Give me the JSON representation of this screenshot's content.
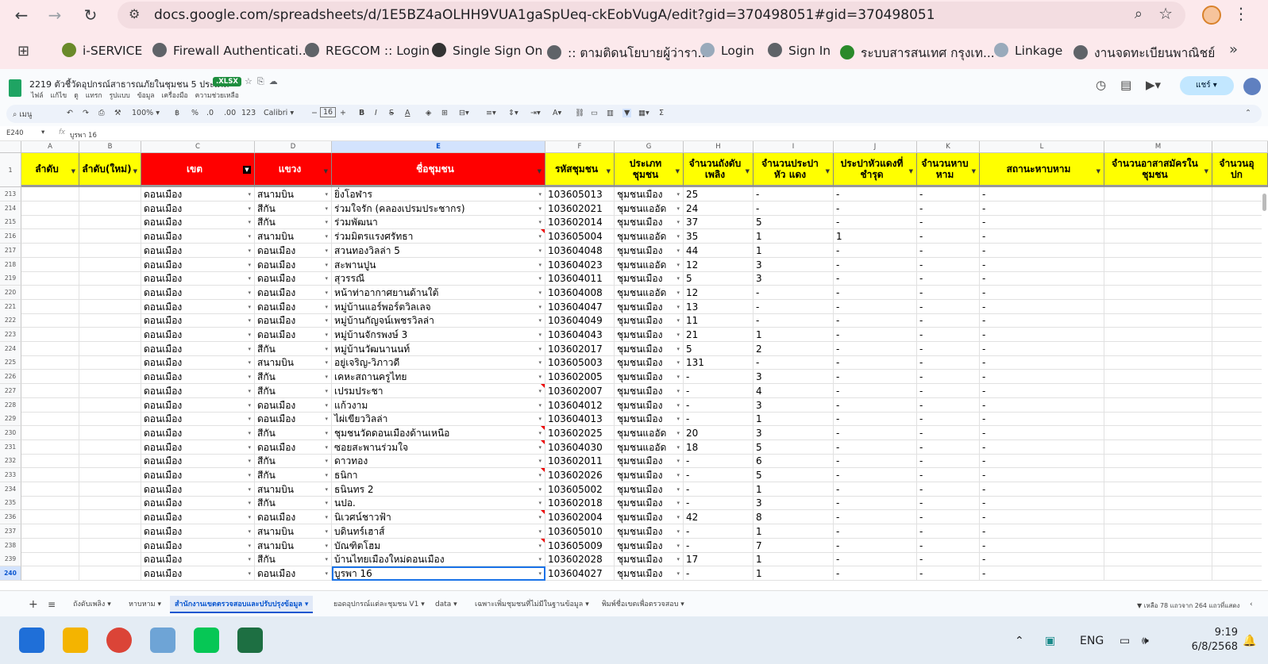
{
  "browser": {
    "url": "docs.google.com/spreadsheets/d/1E5BZ4aOLHH9VUA1gaSpUeq-ckEobVugA/edit?gid=370498051#gid=370498051",
    "bookmarks": [
      "i-SERVICE",
      "Firewall Authenticati...",
      "REGCOM :: Login",
      "Single Sign On",
      ":: ตามติดนโยบายผู้ว่ารา...",
      "Login",
      "Sign In",
      "ระบบสารสนเทศ กรุงเท...",
      "Linkage",
      "งานจดทะเบียนพาณิชย์"
    ]
  },
  "sheet": {
    "title": "2219 ตัวชี้วัดอุปกรณ์สาธารณภัยในชุมชน 5 ประเภท",
    "badge": ".XLSX",
    "menus": [
      "ไฟล์",
      "แก้ไข",
      "ดู",
      "แทรก",
      "รูปแบบ",
      "ข้อมูล",
      "เครื่องมือ",
      "ความช่วยเหลือ"
    ],
    "share_label": "แชร์",
    "toolbar": {
      "search": "เมนู",
      "zoom": "100%",
      "currency": "฿",
      "percent": "%",
      "dec1": ".0",
      "dec2": ".00",
      "fmt": "123",
      "font": "Calibri",
      "size": "16"
    },
    "cell_ref": "E240",
    "formula": "บูรพา 16"
  },
  "columns": {
    "letters": [
      "A",
      "B",
      "C",
      "D",
      "E",
      "F",
      "G",
      "H",
      "I",
      "J",
      "K",
      "L",
      "M",
      ""
    ],
    "headers": [
      "ลำดับ",
      "ลำดับ(ใหม่)",
      "เขต",
      "แขวง",
      "ชื่อชุมชน",
      "รหัสชุมชน",
      "ประเภท ชุมชน",
      "จำนวนถังดับ เพลิง",
      "จำนวนประปาหัว แดง",
      "ประปาหัวแดงที่ ชำรุด",
      "จำนวนหาบ หาม",
      "สถานะหาบหาม",
      "จำนวนอาสาสมัครใน ชุมชน",
      "จำนวนอุปก"
    ]
  },
  "rows": [
    {
      "n": "213",
      "c": "ดอนเมือง",
      "d": "สนามบิน",
      "e": "ยิ่งโอฬาร",
      "f": "103605013",
      "g": "ชุมชนเมือง",
      "h": "25",
      "i": "-",
      "j": "-",
      "k": "-",
      "l": "-"
    },
    {
      "n": "214",
      "c": "ดอนเมือง",
      "d": "สีกัน",
      "e": "ร่วมใจรัก (คลองเปรมประชากร)",
      "f": "103602021",
      "g": "ชุมชนแออัด",
      "h": "24",
      "i": "-",
      "j": "-",
      "k": "-",
      "l": "-"
    },
    {
      "n": "215",
      "c": "ดอนเมือง",
      "d": "สีกัน",
      "e": "ร่วมพัฒนา",
      "f": "103602014",
      "g": "ชุมชนเมือง",
      "h": "37",
      "i": "5",
      "j": "-",
      "k": "-",
      "l": "-"
    },
    {
      "n": "216",
      "c": "ดอนเมือง",
      "d": "สนามบิน",
      "e": "ร่วมมิตรแรงศรัทธา",
      "f": "103605004",
      "g": "ชุมชนแออัด",
      "h": "35",
      "i": "1",
      "j": "1",
      "k": "-",
      "l": "-"
    },
    {
      "n": "217",
      "c": "ดอนเมือง",
      "d": "ดอนเมือง",
      "e": "สวนทองวิลล่า 5",
      "f": "103604048",
      "g": "ชุมชนเมือง",
      "h": "44",
      "i": "1",
      "j": "-",
      "k": "-",
      "l": "-"
    },
    {
      "n": "218",
      "c": "ดอนเมือง",
      "d": "ดอนเมือง",
      "e": "สะพานปูน",
      "f": "103604023",
      "g": "ชุมชนแออัด",
      "h": "12",
      "i": "3",
      "j": "-",
      "k": "-",
      "l": "-"
    },
    {
      "n": "219",
      "c": "ดอนเมือง",
      "d": "ดอนเมือง",
      "e": "สุวรรณี",
      "f": "103604011",
      "g": "ชุมชนเมือง",
      "h": "5",
      "i": "3",
      "j": "-",
      "k": "-",
      "l": "-"
    },
    {
      "n": "220",
      "c": "ดอนเมือง",
      "d": "ดอนเมือง",
      "e": "หน้าท่าอากาศยานด้านใต้",
      "f": "103604008",
      "g": "ชุมชนแออัด",
      "h": "12",
      "i": "-",
      "j": "-",
      "k": "-",
      "l": "-"
    },
    {
      "n": "221",
      "c": "ดอนเมือง",
      "d": "ดอนเมือง",
      "e": "หมู่บ้านแอร์พอร์ตวิลเลจ",
      "f": "103604047",
      "g": "ชุมชนเมือง",
      "h": "13",
      "i": "-",
      "j": "-",
      "k": "-",
      "l": "-"
    },
    {
      "n": "222",
      "c": "ดอนเมือง",
      "d": "ดอนเมือง",
      "e": "หมู่บ้านกัญจน์เพชรวิลล่า",
      "f": "103604049",
      "g": "ชุมชนเมือง",
      "h": "11",
      "i": "-",
      "j": "-",
      "k": "-",
      "l": "-"
    },
    {
      "n": "223",
      "c": "ดอนเมือง",
      "d": "ดอนเมือง",
      "e": "หมู่บ้านจักรพงษ์ 3",
      "f": "103604043",
      "g": "ชุมชนเมือง",
      "h": "21",
      "i": "1",
      "j": "-",
      "k": "-",
      "l": "-"
    },
    {
      "n": "224",
      "c": "ดอนเมือง",
      "d": "สีกัน",
      "e": "หมู่บ้านวัฒนานนท์",
      "f": "103602017",
      "g": "ชุมชนเมือง",
      "h": "5",
      "i": "2",
      "j": "-",
      "k": "-",
      "l": "-"
    },
    {
      "n": "225",
      "c": "ดอนเมือง",
      "d": "สนามบิน",
      "e": "อยู่เจริญ-วิภาวดี",
      "f": "103605003",
      "g": "ชุมชนเมือง",
      "h": "131",
      "i": "-",
      "j": "-",
      "k": "-",
      "l": "-"
    },
    {
      "n": "226",
      "c": "ดอนเมือง",
      "d": "สีกัน",
      "e": "เคหะสถานครูไทย",
      "f": "103602005",
      "g": "ชุมชนเมือง",
      "h": "-",
      "i": "3",
      "j": "-",
      "k": "-",
      "l": "-"
    },
    {
      "n": "227",
      "c": "ดอนเมือง",
      "d": "สีกัน",
      "e": "เปรมประชา",
      "f": "103602007",
      "g": "ชุมชนเมือง",
      "h": "-",
      "i": "4",
      "j": "-",
      "k": "-",
      "l": "-"
    },
    {
      "n": "228",
      "c": "ดอนเมือง",
      "d": "ดอนเมือง",
      "e": "แก้วงาม",
      "f": "103604012",
      "g": "ชุมชนเมือง",
      "h": "-",
      "i": "3",
      "j": "-",
      "k": "-",
      "l": "-"
    },
    {
      "n": "229",
      "c": "ดอนเมือง",
      "d": "ดอนเมือง",
      "e": "ไผ่เขียววิลล่า",
      "f": "103604013",
      "g": "ชุมชนเมือง",
      "h": "-",
      "i": "1",
      "j": "-",
      "k": "-",
      "l": "-"
    },
    {
      "n": "230",
      "c": "ดอนเมือง",
      "d": "สีกัน",
      "e": "ชุมชนวัดดอนเมืองด้านเหนือ",
      "f": "103602025",
      "g": "ชุมชนแออัด",
      "h": "20",
      "i": "3",
      "j": "-",
      "k": "-",
      "l": "-"
    },
    {
      "n": "231",
      "c": "ดอนเมือง",
      "d": "ดอนเมือง",
      "e": "ซอยสะพานร่วมใจ",
      "f": "103604030",
      "g": "ชุมชนแออัด",
      "h": "18",
      "i": "5",
      "j": "-",
      "k": "-",
      "l": "-"
    },
    {
      "n": "232",
      "c": "ดอนเมือง",
      "d": "สีกัน",
      "e": "ดาวทอง",
      "f": "103602011",
      "g": "ชุมชนเมือง",
      "h": "-",
      "i": "6",
      "j": "-",
      "k": "-",
      "l": "-"
    },
    {
      "n": "233",
      "c": "ดอนเมือง",
      "d": "สีกัน",
      "e": "ธนิกา",
      "f": "103602026",
      "g": "ชุมชนเมือง",
      "h": "-",
      "i": "5",
      "j": "-",
      "k": "-",
      "l": "-"
    },
    {
      "n": "234",
      "c": "ดอนเมือง",
      "d": "สนามบิน",
      "e": "ธนินทร 2",
      "f": "103605002",
      "g": "ชุมชนเมือง",
      "h": "-",
      "i": "1",
      "j": "-",
      "k": "-",
      "l": "-"
    },
    {
      "n": "235",
      "c": "ดอนเมือง",
      "d": "สีกัน",
      "e": "นปอ.",
      "f": "103602018",
      "g": "ชุมชนเมือง",
      "h": "-",
      "i": "3",
      "j": "-",
      "k": "-",
      "l": "-"
    },
    {
      "n": "236",
      "c": "ดอนเมือง",
      "d": "ดอนเมือง",
      "e": "นิเวศน์ชาวฟ้า",
      "f": "103602004",
      "g": "ชุมชนเมือง",
      "h": "42",
      "i": "8",
      "j": "-",
      "k": "-",
      "l": "-"
    },
    {
      "n": "237",
      "c": "ดอนเมือง",
      "d": "สนามบิน",
      "e": "บดินทร์เฮาส์",
      "f": "103605010",
      "g": "ชุมชนเมือง",
      "h": "-",
      "i": "1",
      "j": "-",
      "k": "-",
      "l": "-"
    },
    {
      "n": "238",
      "c": "ดอนเมือง",
      "d": "สนามบิน",
      "e": "บัณฑิตโฮม",
      "f": "103605009",
      "g": "ชุมชนเมือง",
      "h": "-",
      "i": "7",
      "j": "-",
      "k": "-",
      "l": "-"
    },
    {
      "n": "239",
      "c": "ดอนเมือง",
      "d": "สีกัน",
      "e": "บ้านไทยเมืองใหม่ดอนเมือง",
      "f": "103602028",
      "g": "ชุมชนเมือง",
      "h": "17",
      "i": "1",
      "j": "-",
      "k": "-",
      "l": "-"
    },
    {
      "n": "240",
      "c": "ดอนเมือง",
      "d": "ดอนเมือง",
      "e": "บูรพา 16",
      "f": "103604027",
      "g": "ชุมชนเมือง",
      "h": "-",
      "i": "1",
      "j": "-",
      "k": "-",
      "l": "-"
    }
  ],
  "tabs": {
    "items": [
      "ถังดับเพลิง",
      "หาบหาม",
      "สำนักงานเขตตรวจสอบและปรับปรุงข้อมูล",
      "ยอดอุปกรณ์แต่ละชุมชน V1",
      "data",
      "เฉพาะเพิ่มชุมชนที่ไม่มีในฐานข้อมูล",
      "พิมพ์ชื่อเขตเพื่อตรวจสอบ"
    ],
    "active": 2,
    "summary": "เหลือ 78 แถวจาก 264 แถวที่แสดง"
  },
  "taskbar": {
    "lang": "ENG",
    "time": "9:19",
    "date": "6/8/2568"
  },
  "colors": {
    "header_yellow": "#ffff00",
    "header_red": "#ff0000",
    "selection": "#1a73e8"
  }
}
